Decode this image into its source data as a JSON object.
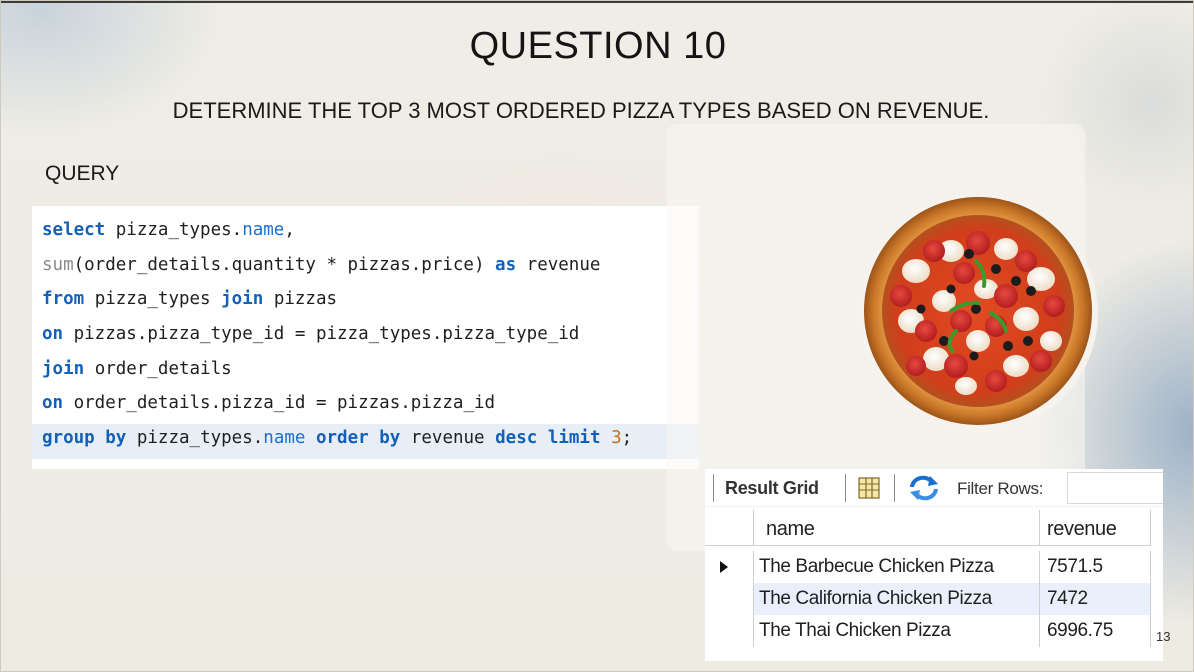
{
  "slide": {
    "title": "QUESTION 10",
    "subtitle": "DETERMINE THE TOP 3 MOST ORDERED PIZZA TYPES BASED ON REVENUE.",
    "query_label": "QUERY",
    "page_number": "13"
  },
  "code": {
    "lines": [
      {
        "select": "select",
        "t1": " pizza_types.",
        "name": "name",
        "t2": ","
      },
      {
        "sum": "sum",
        "t1": "(order_details.quantity * pizzas.price) ",
        "as": "as",
        "t2": " revenue"
      },
      {
        "from": "from",
        "t1": " pizza_types ",
        "join": "join",
        "t2": " pizzas"
      },
      {
        "on": "on",
        "t1": " pizzas.pizza_type_id = pizza_types.pizza_type_id"
      },
      {
        "join": "join",
        "t1": " order_details"
      },
      {
        "on": "on",
        "t1": " order_details.pizza_id = pizzas.pizza_id"
      },
      {
        "group": "group",
        "by1": "by",
        "t1": " pizza_types.",
        "name": "name",
        "order": "order",
        "by2": "by",
        "t2": " revenue ",
        "desc": "desc",
        "limit": "limit",
        "num": "3",
        "t3": ";"
      }
    ]
  },
  "result_grid": {
    "toolbar": {
      "result_label": "Result Grid",
      "filter_label": "Filter Rows:",
      "filter_value": ""
    },
    "columns": [
      "name",
      "revenue"
    ],
    "rows": [
      {
        "name": "The Barbecue Chicken Pizza",
        "revenue": "7571.5"
      },
      {
        "name": "The California Chicken Pizza",
        "revenue": "7472"
      },
      {
        "name": "The Thai Chicken Pizza",
        "revenue": "6996.75"
      }
    ],
    "selected_row": 1
  },
  "icons": {
    "grid_icon": "grid-layout-icon",
    "refresh_icon": "refresh-icon",
    "row_pointer": "row-pointer-icon",
    "pizza": "pizza-image"
  },
  "colors": {
    "keyword": "#1460b8",
    "field": "#1a6fd0",
    "function": "#8a8a8a",
    "number": "#c76f1a",
    "selected_row": "#e9f0fb"
  }
}
